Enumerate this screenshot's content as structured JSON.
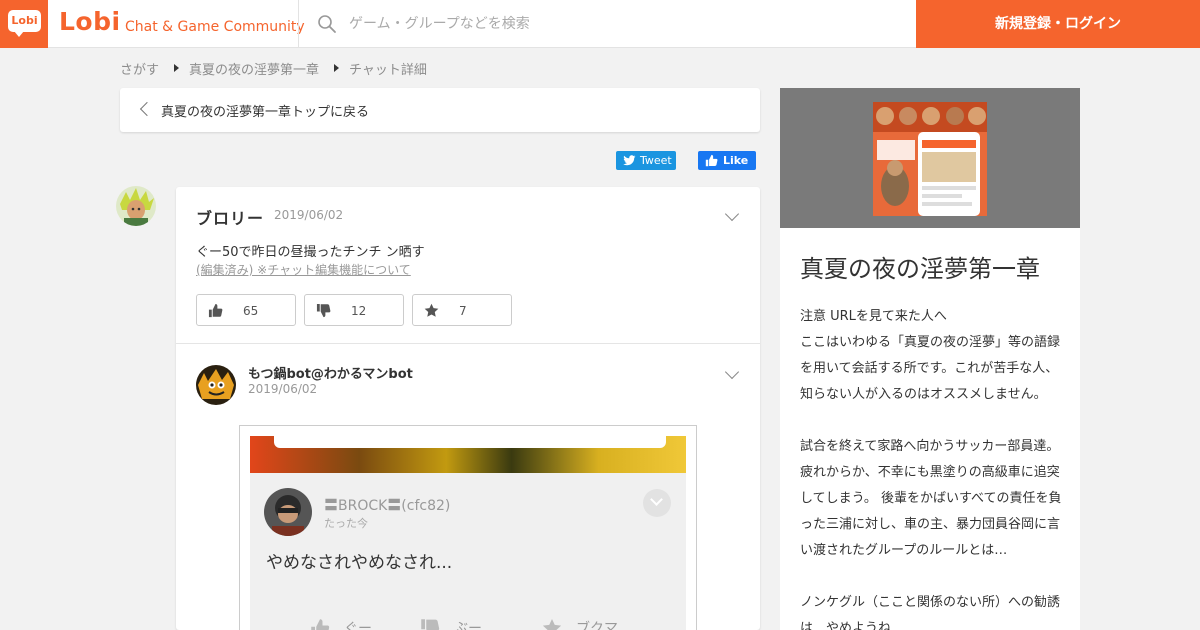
{
  "header": {
    "logo_text": "Lobi",
    "brand": "Lobi",
    "tagline": "Chat & Game Community",
    "search_placeholder": "ゲーム・グループなどを検索",
    "login_label": "新規登録・ログイン"
  },
  "breadcrumb": [
    "さがす",
    "真夏の夜の淫夢第一章",
    "チャット詳細"
  ],
  "back_link": "真夏の夜の淫夢第一章トップに戻る",
  "share": {
    "tweet": "Tweet",
    "like": "Like"
  },
  "posts": [
    {
      "author": "ブロリー",
      "date": "2019/06/02",
      "body": "ぐー50で昨日の昼撮ったチンチ ン晒す",
      "edited_note": "(編集済み) ※チャット編集機能について",
      "reactions": {
        "good": "65",
        "boo": "12",
        "bookmark": "7"
      }
    },
    {
      "author": "もつ鍋bot@わかるマンbot",
      "date": "2019/06/02",
      "screenshot": {
        "name": "〓BROCK〓(cfc82)",
        "time": "たった今",
        "message": "やめなされやめなされ...",
        "actions": {
          "good": "ぐー",
          "boo": "ぶー",
          "bookmark": "ブクマ"
        }
      }
    }
  ],
  "sidebar": {
    "title": "真夏の夜の淫夢第一章",
    "description": [
      "注意 URLを見て来た人へ",
      "ここはいわゆる「真夏の夜の淫夢」等の語録を用いて会話する所です。これが苦手な人、知らない人が入るのはオススメしません。",
      "",
      "試合を終えて家路へ向かうサッカー部員達。疲れからか、不幸にも黒塗りの高級車に追突してしまう。 後輩をかばいすべての責任を負った三浦に対し、車の主、暴力団員谷岡に言い渡されたグループのルールとは…",
      "",
      "ノンケグル（ここと関係のない所）への勧誘は…やめようね"
    ]
  },
  "colors": {
    "accent": "#f5642d",
    "twitter": "#1b95e0",
    "facebook": "#1877f2"
  }
}
